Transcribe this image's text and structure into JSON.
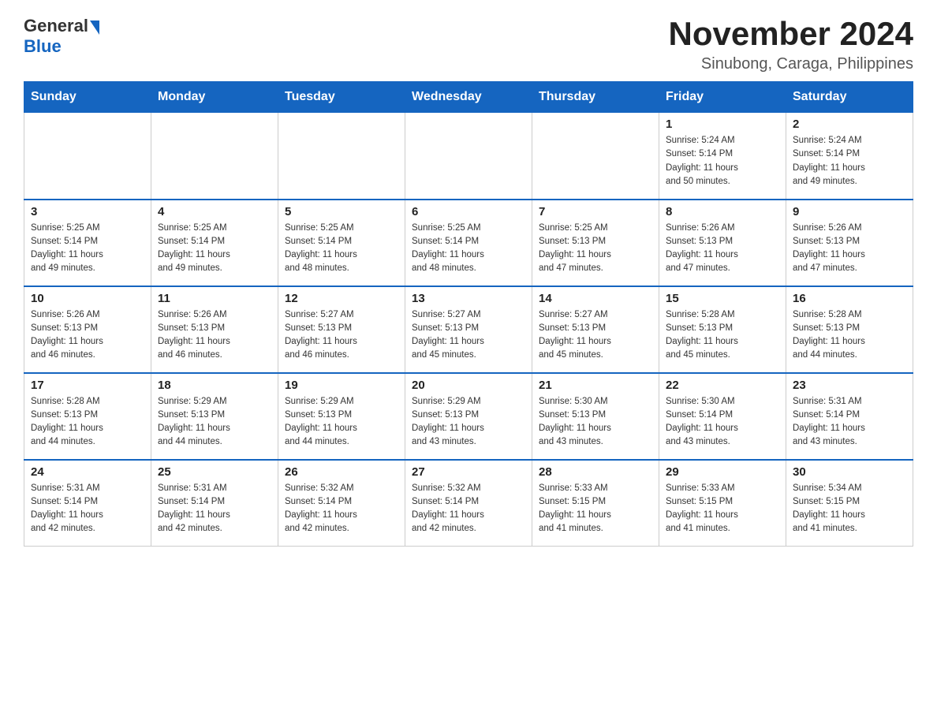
{
  "header": {
    "logo_general": "General",
    "logo_blue": "Blue",
    "month_year": "November 2024",
    "location": "Sinubong, Caraga, Philippines"
  },
  "days_of_week": [
    "Sunday",
    "Monday",
    "Tuesday",
    "Wednesday",
    "Thursday",
    "Friday",
    "Saturday"
  ],
  "weeks": [
    [
      {
        "day": "",
        "info": ""
      },
      {
        "day": "",
        "info": ""
      },
      {
        "day": "",
        "info": ""
      },
      {
        "day": "",
        "info": ""
      },
      {
        "day": "",
        "info": ""
      },
      {
        "day": "1",
        "info": "Sunrise: 5:24 AM\nSunset: 5:14 PM\nDaylight: 11 hours\nand 50 minutes."
      },
      {
        "day": "2",
        "info": "Sunrise: 5:24 AM\nSunset: 5:14 PM\nDaylight: 11 hours\nand 49 minutes."
      }
    ],
    [
      {
        "day": "3",
        "info": "Sunrise: 5:25 AM\nSunset: 5:14 PM\nDaylight: 11 hours\nand 49 minutes."
      },
      {
        "day": "4",
        "info": "Sunrise: 5:25 AM\nSunset: 5:14 PM\nDaylight: 11 hours\nand 49 minutes."
      },
      {
        "day": "5",
        "info": "Sunrise: 5:25 AM\nSunset: 5:14 PM\nDaylight: 11 hours\nand 48 minutes."
      },
      {
        "day": "6",
        "info": "Sunrise: 5:25 AM\nSunset: 5:14 PM\nDaylight: 11 hours\nand 48 minutes."
      },
      {
        "day": "7",
        "info": "Sunrise: 5:25 AM\nSunset: 5:13 PM\nDaylight: 11 hours\nand 47 minutes."
      },
      {
        "day": "8",
        "info": "Sunrise: 5:26 AM\nSunset: 5:13 PM\nDaylight: 11 hours\nand 47 minutes."
      },
      {
        "day": "9",
        "info": "Sunrise: 5:26 AM\nSunset: 5:13 PM\nDaylight: 11 hours\nand 47 minutes."
      }
    ],
    [
      {
        "day": "10",
        "info": "Sunrise: 5:26 AM\nSunset: 5:13 PM\nDaylight: 11 hours\nand 46 minutes."
      },
      {
        "day": "11",
        "info": "Sunrise: 5:26 AM\nSunset: 5:13 PM\nDaylight: 11 hours\nand 46 minutes."
      },
      {
        "day": "12",
        "info": "Sunrise: 5:27 AM\nSunset: 5:13 PM\nDaylight: 11 hours\nand 46 minutes."
      },
      {
        "day": "13",
        "info": "Sunrise: 5:27 AM\nSunset: 5:13 PM\nDaylight: 11 hours\nand 45 minutes."
      },
      {
        "day": "14",
        "info": "Sunrise: 5:27 AM\nSunset: 5:13 PM\nDaylight: 11 hours\nand 45 minutes."
      },
      {
        "day": "15",
        "info": "Sunrise: 5:28 AM\nSunset: 5:13 PM\nDaylight: 11 hours\nand 45 minutes."
      },
      {
        "day": "16",
        "info": "Sunrise: 5:28 AM\nSunset: 5:13 PM\nDaylight: 11 hours\nand 44 minutes."
      }
    ],
    [
      {
        "day": "17",
        "info": "Sunrise: 5:28 AM\nSunset: 5:13 PM\nDaylight: 11 hours\nand 44 minutes."
      },
      {
        "day": "18",
        "info": "Sunrise: 5:29 AM\nSunset: 5:13 PM\nDaylight: 11 hours\nand 44 minutes."
      },
      {
        "day": "19",
        "info": "Sunrise: 5:29 AM\nSunset: 5:13 PM\nDaylight: 11 hours\nand 44 minutes."
      },
      {
        "day": "20",
        "info": "Sunrise: 5:29 AM\nSunset: 5:13 PM\nDaylight: 11 hours\nand 43 minutes."
      },
      {
        "day": "21",
        "info": "Sunrise: 5:30 AM\nSunset: 5:13 PM\nDaylight: 11 hours\nand 43 minutes."
      },
      {
        "day": "22",
        "info": "Sunrise: 5:30 AM\nSunset: 5:14 PM\nDaylight: 11 hours\nand 43 minutes."
      },
      {
        "day": "23",
        "info": "Sunrise: 5:31 AM\nSunset: 5:14 PM\nDaylight: 11 hours\nand 43 minutes."
      }
    ],
    [
      {
        "day": "24",
        "info": "Sunrise: 5:31 AM\nSunset: 5:14 PM\nDaylight: 11 hours\nand 42 minutes."
      },
      {
        "day": "25",
        "info": "Sunrise: 5:31 AM\nSunset: 5:14 PM\nDaylight: 11 hours\nand 42 minutes."
      },
      {
        "day": "26",
        "info": "Sunrise: 5:32 AM\nSunset: 5:14 PM\nDaylight: 11 hours\nand 42 minutes."
      },
      {
        "day": "27",
        "info": "Sunrise: 5:32 AM\nSunset: 5:14 PM\nDaylight: 11 hours\nand 42 minutes."
      },
      {
        "day": "28",
        "info": "Sunrise: 5:33 AM\nSunset: 5:15 PM\nDaylight: 11 hours\nand 41 minutes."
      },
      {
        "day": "29",
        "info": "Sunrise: 5:33 AM\nSunset: 5:15 PM\nDaylight: 11 hours\nand 41 minutes."
      },
      {
        "day": "30",
        "info": "Sunrise: 5:34 AM\nSunset: 5:15 PM\nDaylight: 11 hours\nand 41 minutes."
      }
    ]
  ]
}
